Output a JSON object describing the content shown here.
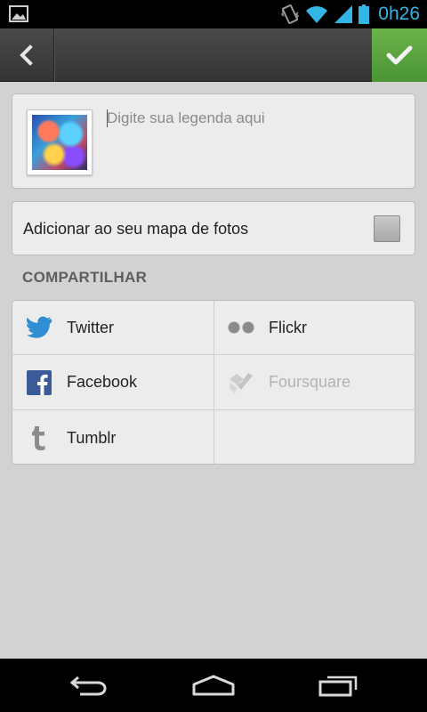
{
  "status_bar": {
    "time": "0h26",
    "icons": [
      "gallery-notification-icon",
      "vibrate-icon",
      "wifi-icon",
      "signal-icon",
      "battery-icon"
    ],
    "accent_color": "#33b5e5"
  },
  "action_bar": {
    "back_icon": "chevron-left-icon",
    "confirm_icon": "checkmark-icon",
    "confirm_color": "#5aa43e"
  },
  "caption": {
    "placeholder": "Digite sua legenda aqui",
    "value": ""
  },
  "map": {
    "label": "Adicionar ao seu mapa de fotos",
    "checked": false
  },
  "share": {
    "title": "COMPARTILHAR",
    "services": [
      {
        "label": "Twitter",
        "icon": "twitter-icon",
        "enabled": true
      },
      {
        "label": "Flickr",
        "icon": "flickr-icon",
        "enabled": true
      },
      {
        "label": "Facebook",
        "icon": "facebook-icon",
        "enabled": true
      },
      {
        "label": "Foursquare",
        "icon": "foursquare-icon",
        "enabled": false
      },
      {
        "label": "Tumblr",
        "icon": "tumblr-icon",
        "enabled": true
      }
    ]
  },
  "nav_bar": {
    "icons": [
      "back-nav-icon",
      "home-nav-icon",
      "recent-apps-icon"
    ]
  }
}
